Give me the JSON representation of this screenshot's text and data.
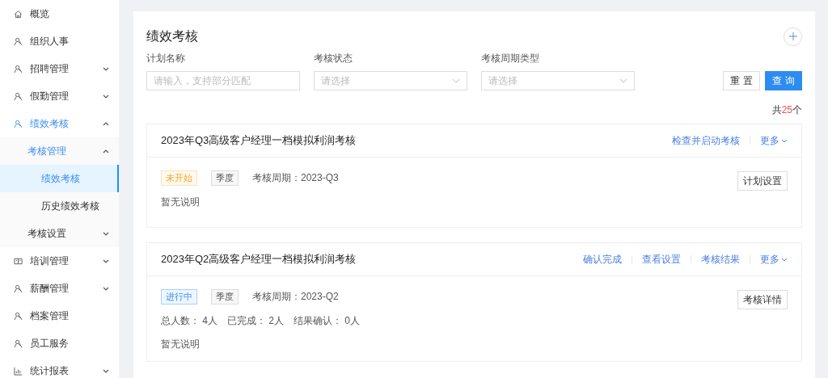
{
  "sidebar": {
    "items": [
      {
        "label": "概览",
        "kind": "home",
        "selected": false
      },
      {
        "label": "组织人事",
        "kind": "person",
        "selected": false
      },
      {
        "label": "招聘管理",
        "kind": "person",
        "selected": false,
        "expanded": false
      },
      {
        "label": "假勤管理",
        "kind": "person",
        "selected": false,
        "expanded": false
      },
      {
        "label": "绩效考核",
        "kind": "person",
        "selected": true,
        "expanded": true,
        "children": [
          {
            "label": "考核管理",
            "selected": true,
            "expanded": true,
            "children": [
              {
                "label": "绩效考核",
                "selected": true
              },
              {
                "label": "历史绩效考核",
                "selected": false
              }
            ]
          },
          {
            "label": "考核设置",
            "selected": false,
            "expanded": false
          }
        ]
      },
      {
        "label": "培训管理",
        "kind": "board",
        "selected": false,
        "expanded": false
      },
      {
        "label": "薪酬管理",
        "kind": "person",
        "selected": false,
        "expanded": false
      },
      {
        "label": "档案管理",
        "kind": "person",
        "selected": false
      },
      {
        "label": "员工服务",
        "kind": "person",
        "selected": false
      },
      {
        "label": "统计报表",
        "kind": "chart",
        "selected": false,
        "expanded": false
      }
    ]
  },
  "page": {
    "title": "绩效考核",
    "filters": [
      {
        "label": "计划名称",
        "kind": "input",
        "placeholder": "请输入，支持部分匹配"
      },
      {
        "label": "考核状态",
        "kind": "select",
        "placeholder": "请选择"
      },
      {
        "label": "考核周期类型",
        "kind": "select",
        "placeholder": "请选择"
      }
    ],
    "buttons": [
      {
        "label": "重 置",
        "kind": "default"
      },
      {
        "label": "查 询",
        "kind": "primary"
      }
    ],
    "count": {
      "prefix": "共",
      "value": "25",
      "suffix": "个"
    },
    "plans": [
      {
        "title": "2023年Q3高级客户经理一档模拟利润考核",
        "actions": [
          "检查并启动考核"
        ],
        "more": "更多",
        "status": {
          "label": "未开始",
          "kind": "pending"
        },
        "tag": "季度",
        "period": "考核周期：2023-Q3",
        "description": "暂无说明",
        "button": "计划设置"
      },
      {
        "title": "2023年Q2高级客户经理一档模拟利润考核",
        "actions": [
          "确认完成",
          "查看设置",
          "考核结果"
        ],
        "more": "更多",
        "status": {
          "label": "进行中",
          "kind": "running"
        },
        "tag": "季度",
        "period": "考核周期：2023-Q2",
        "stats": [
          "总人数：  4人",
          "已完成：  2人",
          "结果确认：  0人"
        ],
        "description": "暂无说明",
        "button": "考核详情"
      }
    ]
  }
}
